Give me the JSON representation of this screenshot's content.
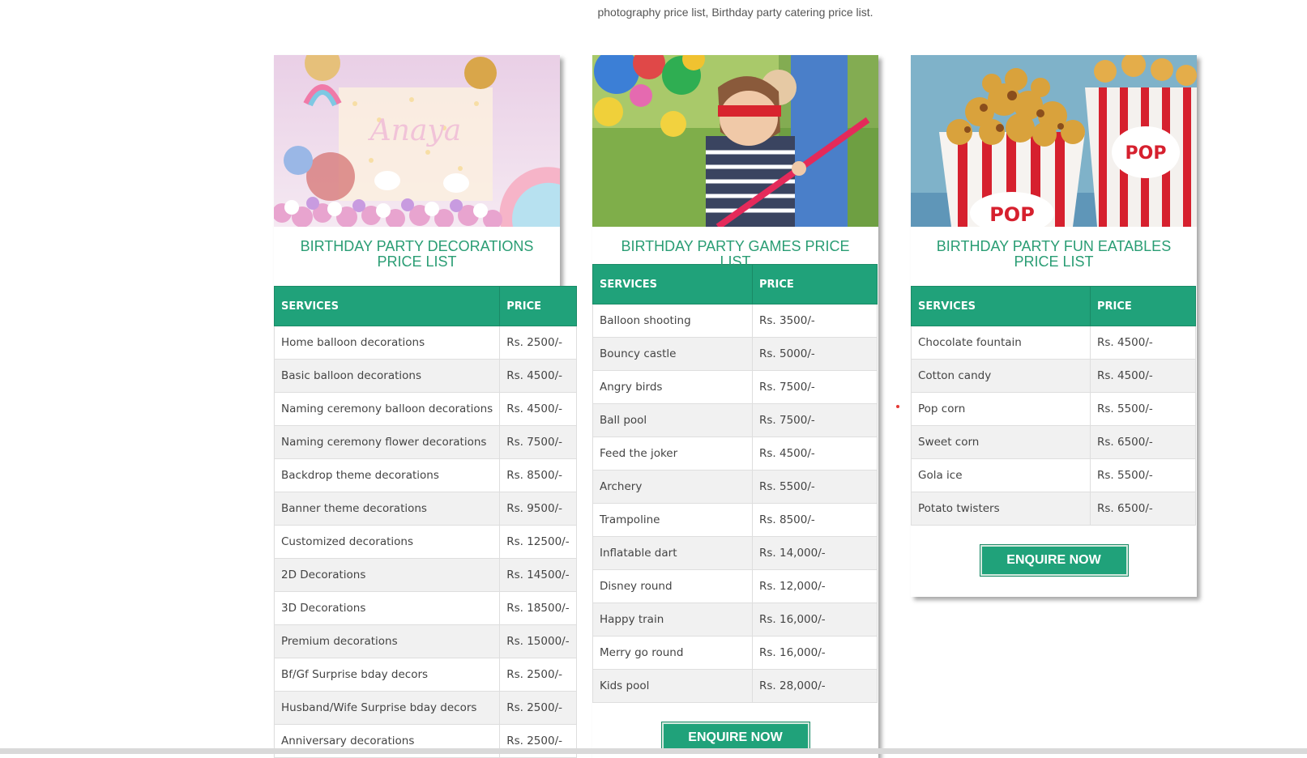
{
  "intro_text": "photography price list, Birthday party catering price list.",
  "colors": {
    "accent": "#20a27a",
    "title": "#2a9d74"
  },
  "cards": [
    {
      "title": "BIRTHDAY PARTY DECORATIONS PRICE LIST",
      "header_services": "SERVICES",
      "header_price": "PRICE",
      "rows": [
        [
          "Home balloon decorations",
          "Rs. 2500/-"
        ],
        [
          "Basic balloon decorations",
          "Rs. 4500/-"
        ],
        [
          "Naming ceremony balloon decorations",
          "Rs. 4500/-"
        ],
        [
          "Naming ceremony flower decorations",
          "Rs. 7500/-"
        ],
        [
          "Backdrop theme decorations",
          "Rs. 8500/-"
        ],
        [
          "Banner theme decorations",
          "Rs. 9500/-"
        ],
        [
          "Customized decorations",
          "Rs. 12500/-"
        ],
        [
          "2D Decorations",
          "Rs. 14500/-"
        ],
        [
          "3D Decorations",
          "Rs. 18500/-"
        ],
        [
          "Premium decorations",
          "Rs. 15000/-"
        ],
        [
          "Bf/Gf Surprise bday decors",
          "Rs. 2500/-"
        ],
        [
          "Husband/Wife Surprise bday decors",
          "Rs. 2500/-"
        ],
        [
          "Anniversary decorations",
          "Rs. 2500/-"
        ]
      ]
    },
    {
      "title": "BIRTHDAY PARTY GAMES PRICE LIST",
      "header_services": "SERVICES",
      "header_price": "PRICE",
      "rows": [
        [
          "Balloon shooting",
          "Rs. 3500/-"
        ],
        [
          "Bouncy castle",
          "Rs. 5000/-"
        ],
        [
          "Angry birds",
          "Rs. 7500/-"
        ],
        [
          "Ball pool",
          "Rs. 7500/-"
        ],
        [
          "Feed the joker",
          "Rs. 4500/-"
        ],
        [
          "Archery",
          "Rs. 5500/-"
        ],
        [
          "Trampoline",
          "Rs. 8500/-"
        ],
        [
          "Inflatable dart",
          "Rs. 14,000/-"
        ],
        [
          "Disney round",
          "Rs. 12,000/-"
        ],
        [
          "Happy train",
          "Rs. 16,000/-"
        ],
        [
          "Merry go round",
          "Rs. 16,000/-"
        ],
        [
          "Kids pool",
          "Rs. 28,000/-"
        ]
      ],
      "button": "ENQUIRE NOW"
    },
    {
      "title": "BIRTHDAY PARTY FUN EATABLES PRICE LIST",
      "header_services": "SERVICES",
      "header_price": "PRICE",
      "rows": [
        [
          "Chocolate fountain",
          "Rs. 4500/-"
        ],
        [
          "Cotton candy",
          "Rs. 4500/-"
        ],
        [
          "Pop corn",
          "Rs. 5500/-"
        ],
        [
          "Sweet corn",
          "Rs. 6500/-"
        ],
        [
          "Gola ice",
          "Rs. 5500/-"
        ],
        [
          "Potato twisters",
          "Rs. 6500/-"
        ]
      ],
      "button": "ENQUIRE NOW"
    }
  ]
}
